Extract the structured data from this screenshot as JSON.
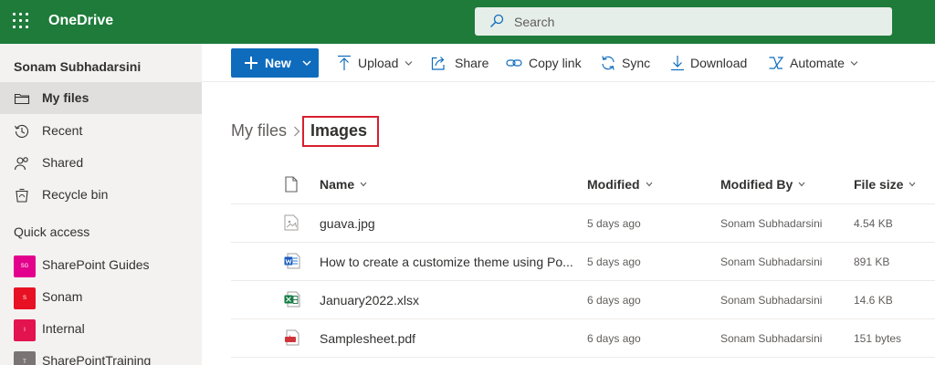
{
  "app": {
    "name": "OneDrive"
  },
  "colors": {
    "brand_bar": "#1e7b3a",
    "primary_button": "#0f6cbd",
    "highlight_box": "#d6202f"
  },
  "search": {
    "placeholder": "Search"
  },
  "sidebar": {
    "user_name": "Sonam Subhadarsini",
    "nav": [
      {
        "label": "My files",
        "icon": "folder-icon",
        "active": true
      },
      {
        "label": "Recent",
        "icon": "history-icon"
      },
      {
        "label": "Shared",
        "icon": "people-icon"
      },
      {
        "label": "Recycle bin",
        "icon": "recycle-bin-icon"
      }
    ],
    "quick_access_title": "Quick access",
    "quick_access": [
      {
        "label": "SharePoint Guides",
        "initials": "SG",
        "color": "#e3008c"
      },
      {
        "label": "Sonam",
        "initials": "S",
        "color": "#e81123"
      },
      {
        "label": "Internal",
        "initials": "I",
        "color": "#e3134f"
      },
      {
        "label": "SharePointTraining",
        "initials": "T",
        "color": "#7a7574"
      }
    ]
  },
  "toolbar": {
    "new_label": "New",
    "upload_label": "Upload",
    "share_label": "Share",
    "copy_link_label": "Copy link",
    "sync_label": "Sync",
    "download_label": "Download",
    "automate_label": "Automate"
  },
  "breadcrumb": {
    "root": "My files",
    "current": "Images"
  },
  "columns": {
    "name": "Name",
    "modified": "Modified",
    "modified_by": "Modified By",
    "file_size": "File size"
  },
  "files": [
    {
      "name": "guava.jpg",
      "type": "image-file-icon",
      "modified": "5 days ago",
      "modified_by": "Sonam Subhadarsini",
      "size": "4.54 KB"
    },
    {
      "name": "How to create a customize theme using Po...",
      "type": "word-file-icon",
      "modified": "5 days ago",
      "modified_by": "Sonam Subhadarsini",
      "size": "891 KB"
    },
    {
      "name": "January2022.xlsx",
      "type": "excel-file-icon",
      "modified": "6 days ago",
      "modified_by": "Sonam Subhadarsini",
      "size": "14.6 KB"
    },
    {
      "name": "Samplesheet.pdf",
      "type": "pdf-file-icon",
      "modified": "6 days ago",
      "modified_by": "Sonam Subhadarsini",
      "size": "151 bytes"
    }
  ]
}
